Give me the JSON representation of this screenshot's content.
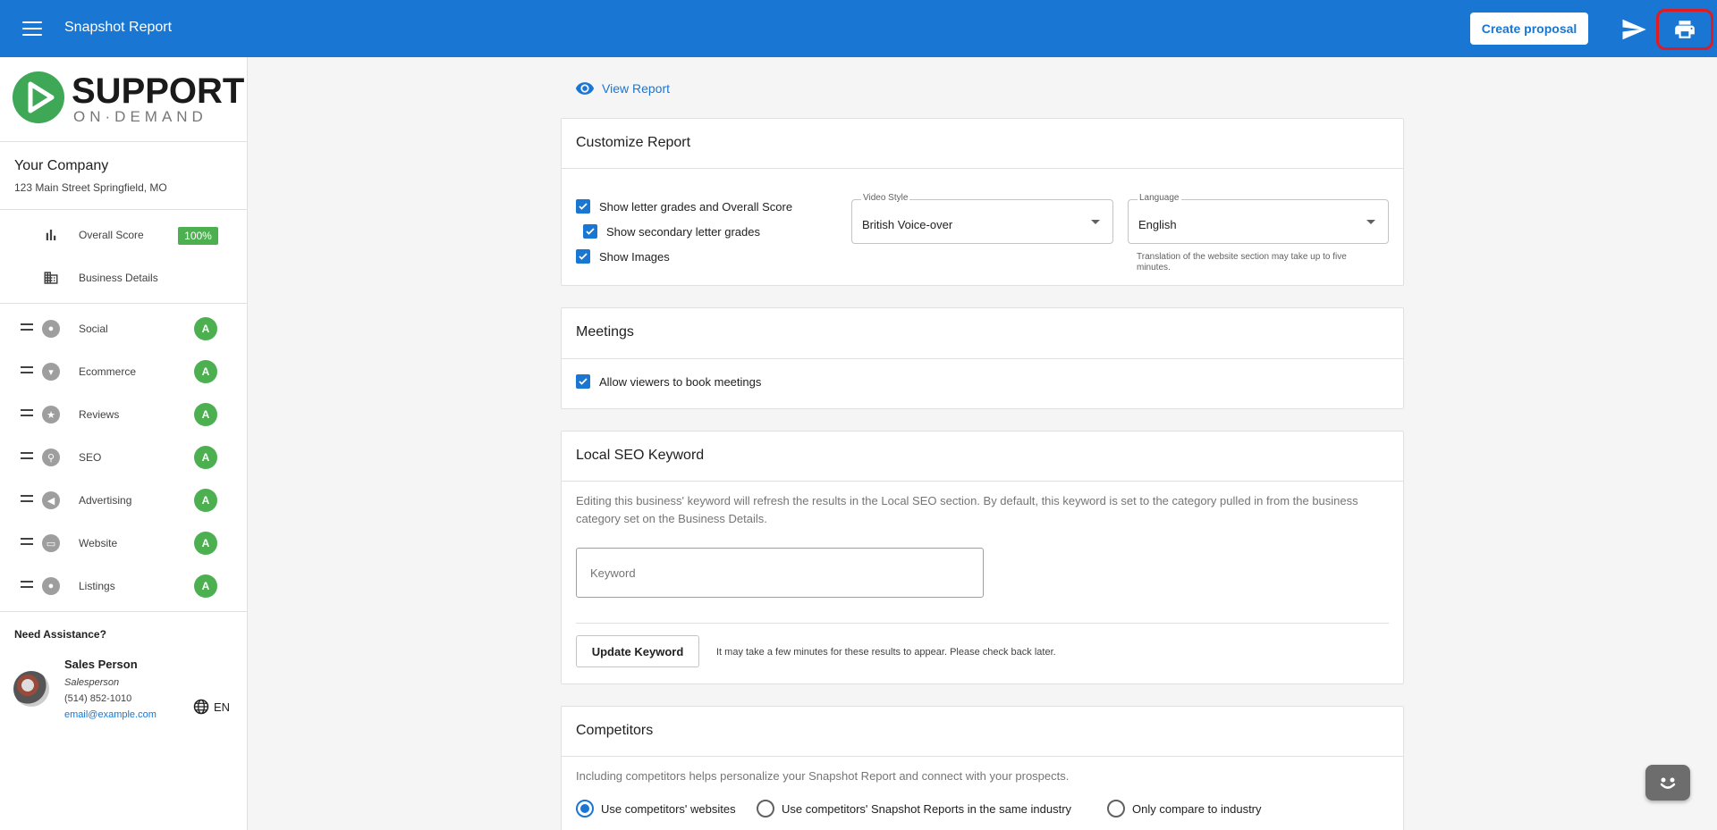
{
  "topbar": {
    "title": "Snapshot Report",
    "create_label": "Create proposal",
    "bg_color": "#1976d2"
  },
  "sidebar": {
    "logo_word1": "SUPPORT",
    "logo_word2": "ON·DEMAND",
    "company_name": "Your Company",
    "company_address": "123 Main Street Springfield, MO",
    "overall_label": "Overall Score",
    "overall_value": "100%",
    "business_details_label": "Business Details",
    "sections": [
      {
        "label": "Social",
        "grade": "A",
        "icon": "social-icon"
      },
      {
        "label": "Ecommerce",
        "grade": "A",
        "icon": "cart-icon"
      },
      {
        "label": "Reviews",
        "grade": "A",
        "icon": "star-icon"
      },
      {
        "label": "SEO",
        "grade": "A",
        "icon": "search-icon"
      },
      {
        "label": "Advertising",
        "grade": "A",
        "icon": "megaphone-icon"
      },
      {
        "label": "Website",
        "grade": "A",
        "icon": "browser-icon"
      },
      {
        "label": "Listings",
        "grade": "A",
        "icon": "pin-icon"
      }
    ],
    "assist_title": "Need Assistance?",
    "sales_name": "Sales Person",
    "sales_role": "Salesperson",
    "sales_phone": "(514) 852-1010",
    "sales_email": "email@example.com",
    "language": "EN"
  },
  "main": {
    "view_report": "View Report",
    "customize": {
      "title": "Customize Report",
      "chk_grades": "Show letter grades and Overall Score",
      "chk_secondary": "Show secondary letter grades",
      "chk_images": "Show Images",
      "video_label": "Video Style",
      "video_value": "British Voice-over",
      "lang_label": "Language",
      "lang_value": "English",
      "lang_helper": "Translation of the website section may take up to five minutes."
    },
    "meetings": {
      "title": "Meetings",
      "chk_book": "Allow viewers to book meetings"
    },
    "seo": {
      "title": "Local SEO Keyword",
      "desc": "Editing this business' keyword will refresh the results in the Local SEO section. By default, this keyword is set to the category pulled in from the business category set on the Business Details.",
      "keyword_placeholder": "Keyword",
      "update_label": "Update Keyword",
      "update_note": "It may take a few minutes for these results to appear. Please check back later."
    },
    "competitors": {
      "title": "Competitors",
      "desc": "Including competitors helps personalize your Snapshot Report and connect with your prospects.",
      "opt1": "Use competitors' websites",
      "opt2": "Use competitors' Snapshot Reports in the same industry",
      "opt3": "Only compare to industry"
    }
  }
}
